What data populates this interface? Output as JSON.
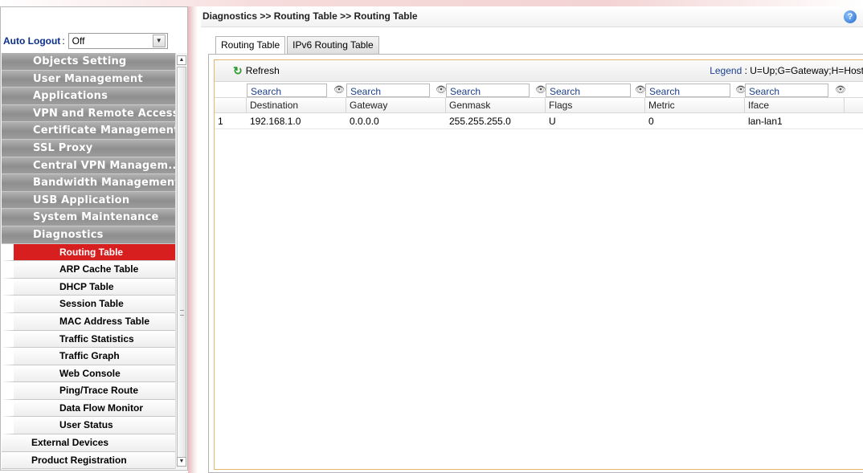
{
  "sidebar": {
    "autologout": {
      "label": "Auto Logout",
      "colon": ":",
      "value": "Off"
    },
    "menu": [
      {
        "label": "Objects Setting"
      },
      {
        "label": "User Management"
      },
      {
        "label": "Applications"
      },
      {
        "label": "VPN and Remote Access"
      },
      {
        "label": "Certificate Management"
      },
      {
        "label": "SSL Proxy"
      },
      {
        "label": "Central VPN Managem..."
      },
      {
        "label": "Bandwidth Management"
      },
      {
        "label": "USB Application"
      },
      {
        "label": "System Maintenance"
      },
      {
        "label": "Diagnostics"
      }
    ],
    "submenu": [
      {
        "label": "Routing Table",
        "active": true
      },
      {
        "label": "ARP Cache Table"
      },
      {
        "label": "DHCP Table"
      },
      {
        "label": "Session Table"
      },
      {
        "label": "MAC Address Table"
      },
      {
        "label": "Traffic Statistics"
      },
      {
        "label": "Traffic Graph"
      },
      {
        "label": "Web Console"
      },
      {
        "label": "Ping/Trace Route"
      },
      {
        "label": "Data Flow Monitor"
      },
      {
        "label": "User Status"
      }
    ],
    "flat": [
      {
        "label": "External Devices"
      },
      {
        "label": "Product Registration"
      }
    ]
  },
  "main": {
    "breadcrumb": "Diagnostics >> Routing Table >> Routing Table",
    "tabs": [
      {
        "label": "Routing Table",
        "active": true
      },
      {
        "label": "IPv6 Routing Table",
        "active": false
      }
    ],
    "toolbar": {
      "refresh_label": "Refresh",
      "legend_label": "Legend",
      "legend_sep": " : ",
      "legend_value": "U=Up;G=Gateway;H=Host"
    },
    "search_placeholder": "Search",
    "columns": [
      "Destination",
      "Gateway",
      "Genmask",
      "Flags",
      "Metric",
      "Iface"
    ],
    "rows": [
      {
        "index": "1",
        "cells": [
          "192.168.1.0",
          "0.0.0.0",
          "255.255.255.0",
          "U",
          "0",
          "lan-lan1"
        ]
      }
    ]
  },
  "colors": {
    "active_menu": "#d71f1f",
    "menu_gray": "#9d9d9d",
    "grid_border": "#e4b86c",
    "link_blue": "#1a3f8f"
  },
  "icons": {
    "help": "help-icon",
    "refresh": "refresh-icon",
    "search_clear": "eye-icon"
  }
}
